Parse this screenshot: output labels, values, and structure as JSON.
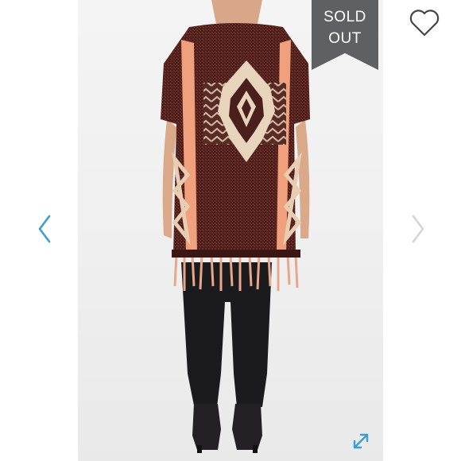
{
  "listing": {
    "badge": {
      "line1": "SOLD",
      "line2": "OUT"
    },
    "favorite_icon": "heart-outline-icon",
    "prev_icon": "chevron-left-icon",
    "next_icon": "chevron-right-icon",
    "expand_icon": "expand-arrows-icon"
  },
  "colors": {
    "badge_bg": "#5f6061",
    "arrow_active": "#3aa0c8",
    "arrow_inactive": "#d4d4d4",
    "heart_stroke": "#444444"
  }
}
